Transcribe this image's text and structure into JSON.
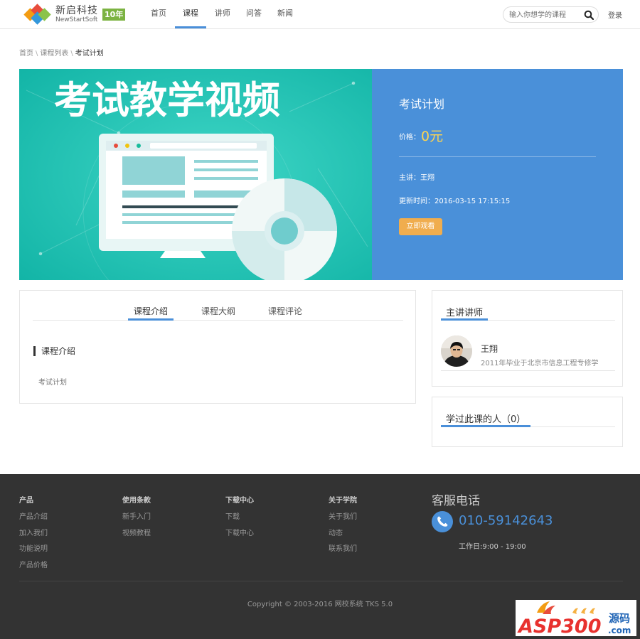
{
  "header": {
    "logo_cn": "新启科技",
    "logo_en": "NewStartSoft",
    "logo_badge": "10年",
    "nav": [
      "首页",
      "课程",
      "讲师",
      "问答",
      "新闻"
    ],
    "nav_active_index": 1,
    "search_placeholder": "输入你想学的课程",
    "login": "登录"
  },
  "breadcrumb": {
    "items": [
      "首页",
      "课程列表",
      "考试计划"
    ],
    "separator": "\\"
  },
  "hero": {
    "image_text": "考试教学视频",
    "title": "考试计划",
    "price_label": "价格：",
    "price": "0元",
    "teacher": "主讲：王翔",
    "updated": "更新时间：2016-03-15 17:15:15",
    "button": "立即观看"
  },
  "content": {
    "tabs": [
      "课程介绍",
      "课程大纲",
      "课程评论"
    ],
    "active_tab": 0,
    "section_title": "课程介绍",
    "section_body": "考试计划"
  },
  "teacher_card": {
    "title": "主讲讲师",
    "name": "王翔",
    "desc": "2011年毕业于北京市信息工程专修学"
  },
  "learners_card": {
    "title": "学过此课的人（0）"
  },
  "footer": {
    "columns": [
      {
        "title": "产品",
        "items": [
          "产品介绍",
          "加入我们",
          "功能说明",
          "产品价格"
        ]
      },
      {
        "title": "使用条款",
        "items": [
          "新手入门",
          "视频教程"
        ]
      },
      {
        "title": "下载中心",
        "items": [
          "下载",
          "下载中心"
        ]
      },
      {
        "title": "关于学院",
        "items": [
          "关于我们",
          "动态",
          "联系我们"
        ]
      }
    ],
    "phone_title": "客服电话",
    "phone": "010-59142643",
    "hours": "工作日:9:00 - 19:00",
    "copyright": "Copyright © 2003-2016 网校系统 TKS 5.0"
  },
  "watermark": {
    "brand": "ASP300",
    "suffix": "源码",
    "domain": ".com"
  },
  "colors": {
    "accent": "#4a90d9",
    "price": "#ffd54f",
    "button": "#f0ad4e",
    "footer_bg": "#333333",
    "hero_bg": "#1fbfb0"
  }
}
